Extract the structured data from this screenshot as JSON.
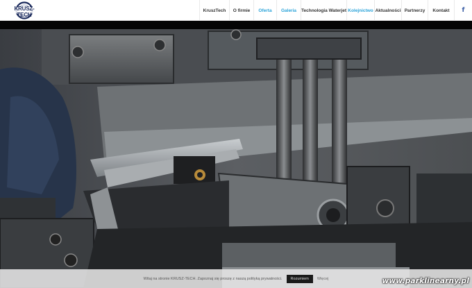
{
  "header": {
    "logo_text": "KRUSZ-TECH",
    "nav": [
      {
        "label": "KruszTech",
        "accent": false
      },
      {
        "label": "O firmie",
        "accent": false
      },
      {
        "label": "Oferta",
        "accent": true
      },
      {
        "label": "Galeria",
        "accent": true
      },
      {
        "label": "Technologia Waterjet",
        "accent": false
      },
      {
        "label": "Kolejnictwo",
        "accent": true
      },
      {
        "label": "Aktualności",
        "accent": false
      },
      {
        "label": "Partnerzy",
        "accent": false
      },
      {
        "label": "Kontakt",
        "accent": false
      }
    ],
    "social_icon": "facebook-icon",
    "social_glyph": "f"
  },
  "hero": {
    "image": "press-brake-machine-photo"
  },
  "cookie_bar": {
    "text": "Witaj na stronie KRUSZ-TECH. Zapoznaj się proszę z naszą polityką prywatności.",
    "accept_label": "Rozumiem",
    "more_label": "Więcej"
  },
  "watermark": "www.parklinearny.pl",
  "colors": {
    "accent": "#2aa3d9",
    "brand_dark": "#1b2a5c"
  }
}
